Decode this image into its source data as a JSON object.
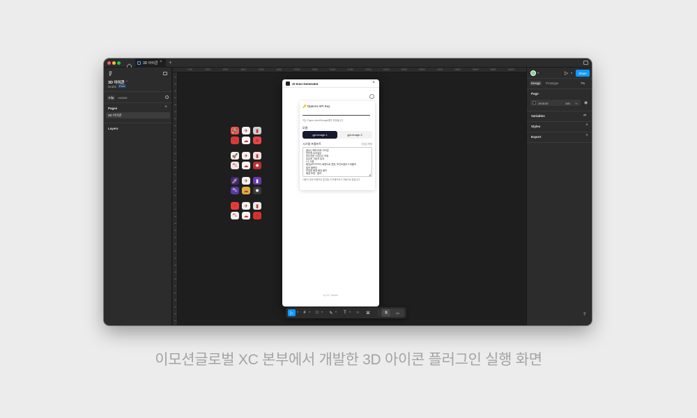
{
  "titlebar": {
    "tab_label": "3D 아이콘",
    "tab_close": "×",
    "new_tab": "+"
  },
  "left_panel": {
    "file_name": "3D 아이콘",
    "file_chevron": "⌄",
    "drafts": "Drafts",
    "plan_badge": "Free",
    "tab_file": "File",
    "tab_assets": "Assets",
    "pages_heading": "Pages",
    "pages_add": "+",
    "page_item": "3D 아이콘",
    "layers_heading": "Layers"
  },
  "ruler": {
    "ticks": [
      "-7000",
      "-7500",
      "-8000",
      "-8500",
      "-9000",
      "-9500",
      "10000",
      "10500",
      "11000",
      "11500",
      "12000",
      "12500",
      "13000",
      "13500",
      "14000",
      "14500",
      "15000",
      "15500",
      "16000",
      "16500",
      "17000",
      "17500"
    ]
  },
  "canvas_icons": {
    "rows": [
      [
        {
          "glyph": "🚀",
          "color": "#e85a4f"
        },
        {
          "glyph": "✈",
          "color": "#f0f0f0"
        },
        {
          "glyph": "▮",
          "color": "#cfcfcf"
        }
      ],
      [
        {
          "glyph": "⛍",
          "color": "#d63a3a"
        },
        {
          "glyph": "☁",
          "color": "#f4f4f4"
        },
        {
          "glyph": "✹",
          "color": "#e04848"
        }
      ],
      [
        {
          "glyph": "🚀",
          "color": "#f2f2f2"
        },
        {
          "glyph": "✈",
          "color": "#f2f2f2"
        },
        {
          "glyph": "▮",
          "color": "#f0dede"
        }
      ],
      [
        {
          "glyph": "⛍",
          "color": "#f0e6e6"
        },
        {
          "glyph": "☁",
          "color": "#f4f4f4"
        },
        {
          "glyph": "✹",
          "color": "#b83030"
        }
      ],
      [
        {
          "glyph": "🚀",
          "color": "#3a2a7a"
        },
        {
          "glyph": "✈",
          "color": "#f2f2f2"
        },
        {
          "glyph": "▮",
          "color": "#6a3ab0"
        }
      ],
      [
        {
          "glyph": "⛍",
          "color": "#5a3aa8"
        },
        {
          "glyph": "☁",
          "color": "#d8b040"
        },
        {
          "glyph": "✹",
          "color": "#3a3a3a"
        }
      ],
      [
        {
          "glyph": "e",
          "color": "#e83a3a"
        },
        {
          "glyph": "✈",
          "color": "#f2f2f2"
        },
        {
          "glyph": "▮",
          "color": "#e8e8e8"
        }
      ],
      [
        {
          "glyph": "⛍",
          "color": "#f0f0f0"
        },
        {
          "glyph": "☁",
          "color": "#f4f4f4"
        },
        {
          "glyph": "✹",
          "color": "#d83030"
        }
      ]
    ]
  },
  "plugin": {
    "title": "AI Icon Generator",
    "close": "×",
    "api_title": "🔑 OpenAI API Key",
    "api_value": "",
    "api_note": "키는 Figma clientStorage에만 저장됩니다",
    "model_label": "모델",
    "model_options": [
      "gpt-image-1",
      "gpt-image-2"
    ],
    "model_selected": "gpt-image-1",
    "system_prompt_label": "시스템 프롬프트",
    "reset_label": "기본값 복원",
    "system_prompt_lines": [
      "[필수] 3에디터트 아이콘",
      "반투명 유리질감",
      "부드러운 스튜디오 조명",
      "은은한 그림자 효과",
      "1:1 사용",
      "중앙(#FFFFFF) 배경으로 표현, 포인트컬러 3 비율의",
      "컬러 블렌딩",
      "투명한 배경 중앙 배치",
      "배경 투명 · 컬러"
    ],
    "prompt_help": "사용자 입력 프롬프트 앞뒤에 이 프롬프트가 자동으로 붙습니다.",
    "footer": "by XC Studio"
  },
  "toolbar": {
    "move": "▷",
    "frame": "#",
    "rect": "□",
    "pen": "✎",
    "text": "T",
    "comment": "○",
    "actions": "⌘",
    "dev_a": "⧉",
    "dev_b": "</>"
  },
  "right_panel": {
    "share": "Share",
    "tab_design": "Design",
    "tab_prototype": "Prototype",
    "zoom": "7%",
    "page_heading": "Page",
    "page_color_hex": "1E1E1E",
    "page_opacity": "100",
    "page_opacity_unit": "%",
    "variables_heading": "Variables",
    "styles_heading": "Styles",
    "export_heading": "Export",
    "help": "?"
  },
  "caption": "이모션글로벌 XC 본부에서 개발한 3D 아이콘 플러그인 실행 화면"
}
